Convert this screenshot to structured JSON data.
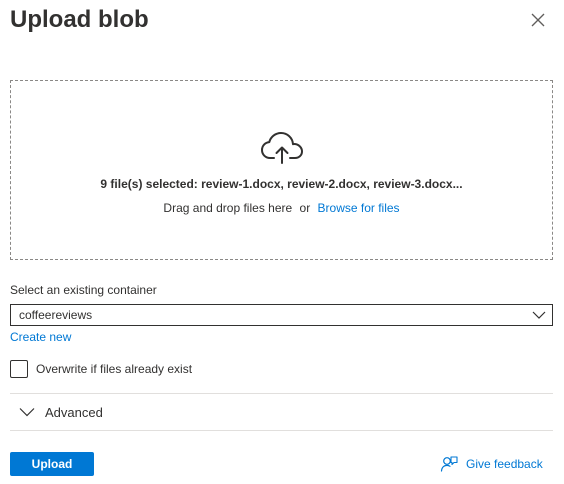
{
  "panel": {
    "title": "Upload blob",
    "close_icon": "close-icon"
  },
  "dropzone": {
    "icon": "cloud-upload-icon",
    "selected_text": "9 file(s) selected: review-1.docx, review-2.docx, review-3.docx...",
    "drag_text": "Drag and drop files here",
    "or_text": "or",
    "browse_link": "Browse for files"
  },
  "container": {
    "label": "Select an existing container",
    "selected_value": "coffeereviews",
    "chevron_icon": "chevron-down-icon",
    "create_new_link": "Create new"
  },
  "overwrite": {
    "label": "Overwrite if files already exist",
    "checked": false
  },
  "advanced": {
    "label": "Advanced",
    "chevron_icon": "chevron-down-icon",
    "expanded": false
  },
  "footer": {
    "upload_label": "Upload",
    "feedback_label": "Give feedback",
    "feedback_icon": "feedback-icon"
  },
  "colors": {
    "accent": "#0078d4",
    "text": "#323130",
    "divider": "#e1dfdd",
    "dropzone_border": "#8a8886"
  }
}
